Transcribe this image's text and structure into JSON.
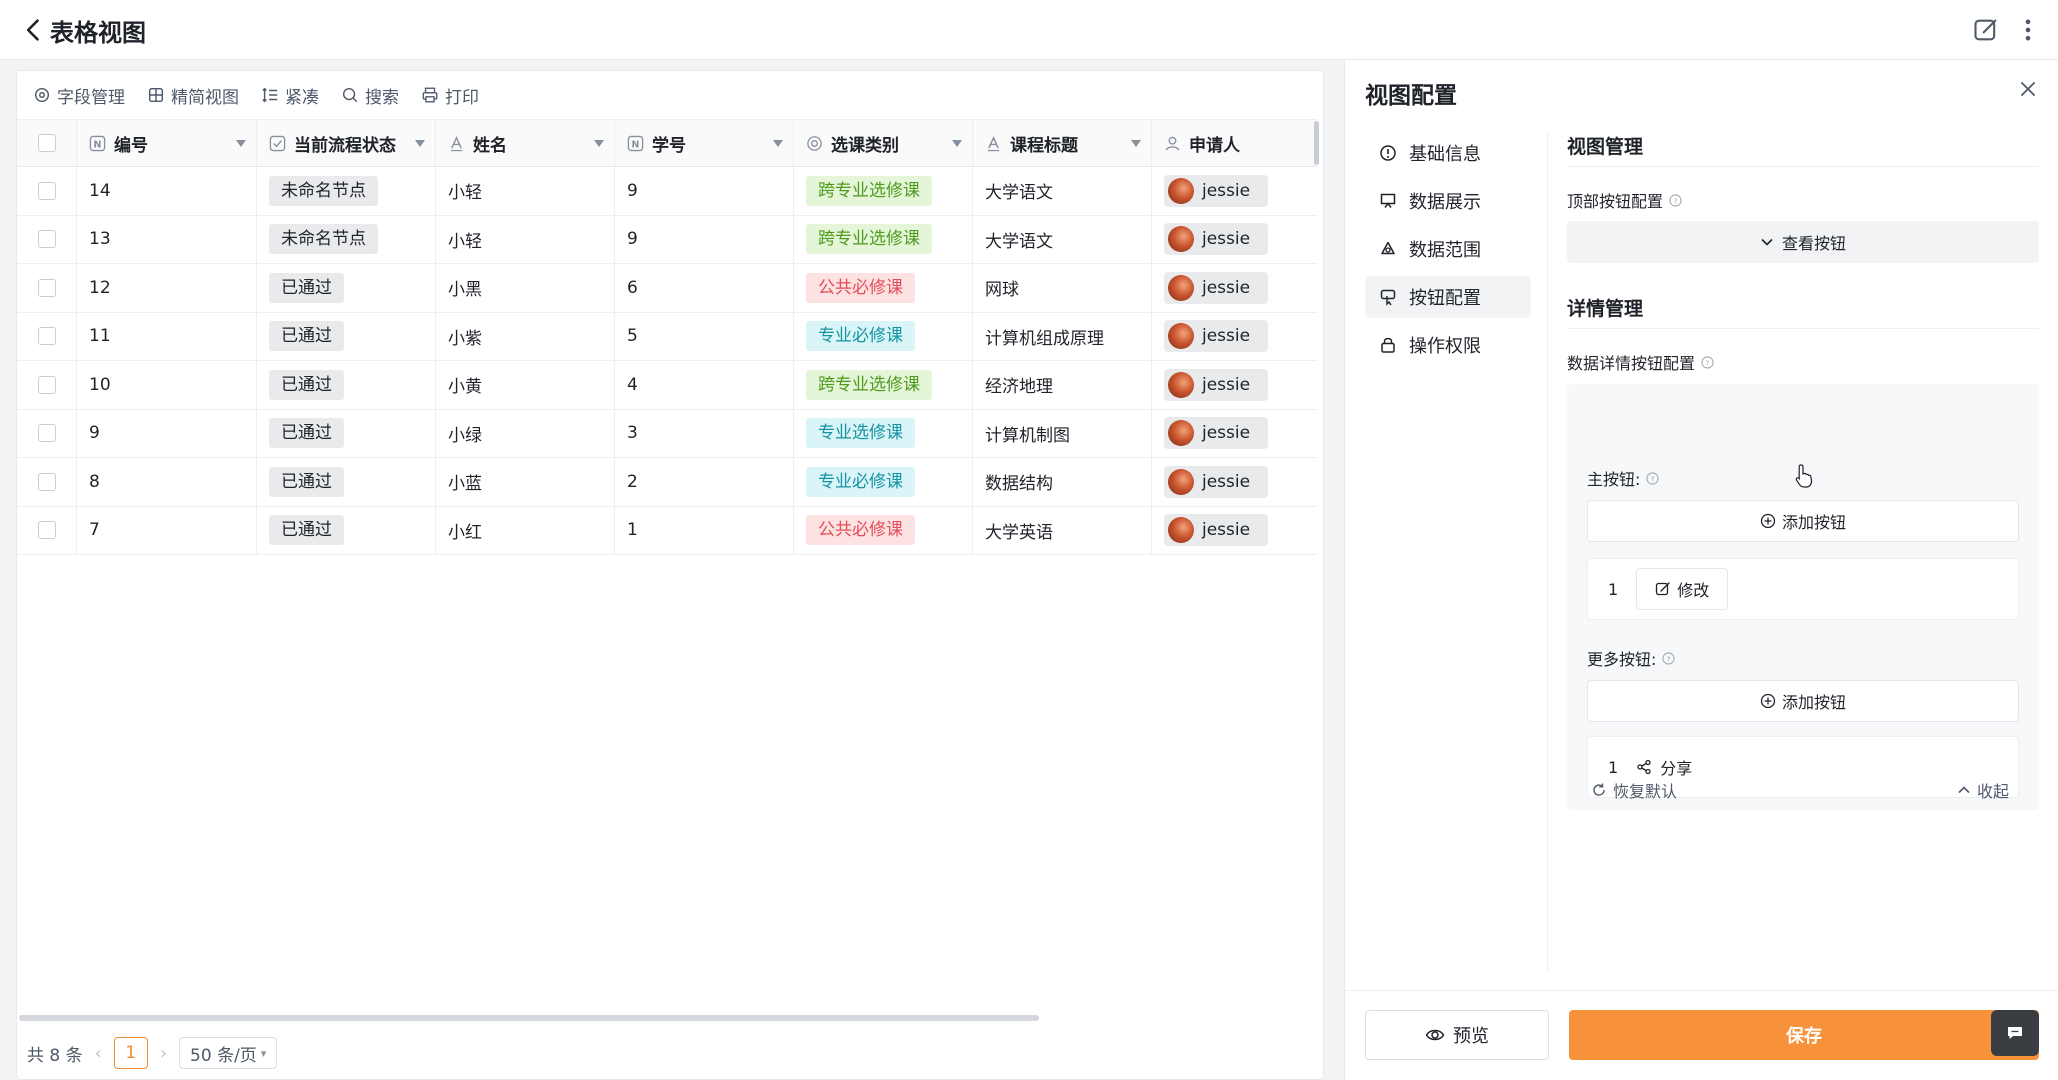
{
  "header": {
    "title": "表格视图"
  },
  "toolbar": {
    "field_manage": "字段管理",
    "simple_view": "精简视图",
    "compact": "紧凑",
    "search": "搜索",
    "print": "打印"
  },
  "table": {
    "columns": [
      "编号",
      "当前流程状态",
      "姓名",
      "学号",
      "选课类别",
      "课程标题",
      "申请人"
    ],
    "rows": [
      {
        "id": "14",
        "status": "未命名节点",
        "name": "小轻",
        "sno": "9",
        "category": "跨专业选修课",
        "cat_color": "green",
        "course": "大学语文",
        "applicant": "jessie"
      },
      {
        "id": "13",
        "status": "未命名节点",
        "name": "小轻",
        "sno": "9",
        "category": "跨专业选修课",
        "cat_color": "green",
        "course": "大学语文",
        "applicant": "jessie"
      },
      {
        "id": "12",
        "status": "已通过",
        "name": "小黑",
        "sno": "6",
        "category": "公共必修课",
        "cat_color": "red",
        "course": "网球",
        "applicant": "jessie"
      },
      {
        "id": "11",
        "status": "已通过",
        "name": "小紫",
        "sno": "5",
        "category": "专业必修课",
        "cat_color": "cyan",
        "course": "计算机组成原理",
        "applicant": "jessie"
      },
      {
        "id": "10",
        "status": "已通过",
        "name": "小黄",
        "sno": "4",
        "category": "跨专业选修课",
        "cat_color": "green",
        "course": "经济地理",
        "applicant": "jessie"
      },
      {
        "id": "9",
        "status": "已通过",
        "name": "小绿",
        "sno": "3",
        "category": "专业选修课",
        "cat_color": "cyan",
        "course": "计算机制图",
        "applicant": "jessie"
      },
      {
        "id": "8",
        "status": "已通过",
        "name": "小蓝",
        "sno": "2",
        "category": "专业必修课",
        "cat_color": "cyan",
        "course": "数据结构",
        "applicant": "jessie"
      },
      {
        "id": "7",
        "status": "已通过",
        "name": "小红",
        "sno": "1",
        "category": "公共必修课",
        "cat_color": "red",
        "course": "大学英语",
        "applicant": "jessie"
      }
    ]
  },
  "pager": {
    "total": "共 8 条",
    "current": "1",
    "page_size": "50 条/页"
  },
  "config": {
    "title": "视图配置",
    "nav": [
      "基础信息",
      "数据展示",
      "数据范围",
      "按钮配置",
      "操作权限"
    ],
    "view_manage": "视图管理",
    "top_btn_config": "顶部按钮配置",
    "view_buttons": "查看按钮",
    "detail_manage": "详情管理",
    "detail_btn_config": "数据详情按钮配置",
    "main_buttons": "主按钮:",
    "add_button": "添加按钮",
    "main_item_index": "1",
    "main_item_label": "修改",
    "more_buttons": "更多按钮:",
    "more_item_index": "1",
    "more_item_label": "分享",
    "restore_default": "恢复默认",
    "collapse": "收起",
    "preview": "预览",
    "save": "保存"
  },
  "colors": {
    "accent": "#f7913a",
    "tag_green": "#e5f6d8",
    "tag_red": "#fde2e2",
    "tag_cyan": "#d9f5f7"
  }
}
